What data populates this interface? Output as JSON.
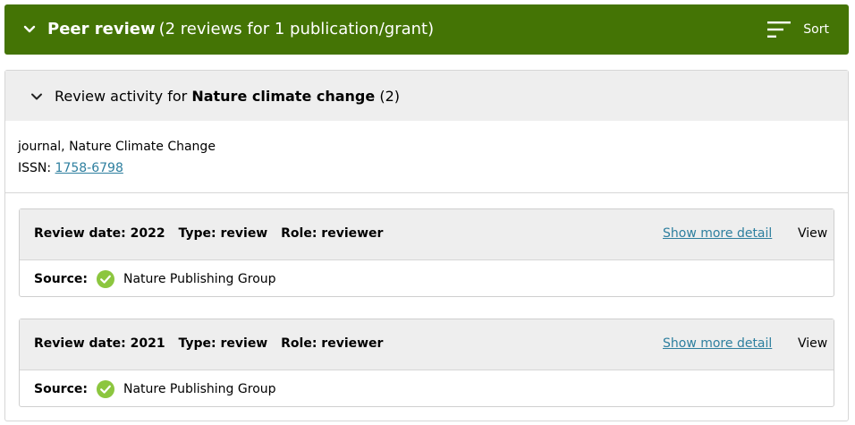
{
  "header": {
    "title": "Peer review",
    "count": "(2 reviews for 1 publication/grant)",
    "sort_label": "Sort"
  },
  "group": {
    "prefix": "Review activity for",
    "journal": "Nature climate change",
    "count": "(2)",
    "type_line": "journal, Nature Climate Change",
    "issn_label": "ISSN:",
    "issn_value": "1758-6798"
  },
  "reviews": [
    {
      "date": "Review date: 2022",
      "type": "Type: review",
      "role": "Role: reviewer",
      "more_label": "Show more detail",
      "view_label": "View",
      "source_label": "Source:",
      "source_value": "Nature Publishing Group"
    },
    {
      "date": "Review date: 2021",
      "type": "Type: review",
      "role": "Role: reviewer",
      "more_label": "Show more detail",
      "view_label": "View",
      "source_label": "Source:",
      "source_value": "Nature Publishing Group"
    }
  ],
  "colors": {
    "header_bg": "#447405",
    "link": "#2e7f9f",
    "check": "#8cc63f"
  }
}
